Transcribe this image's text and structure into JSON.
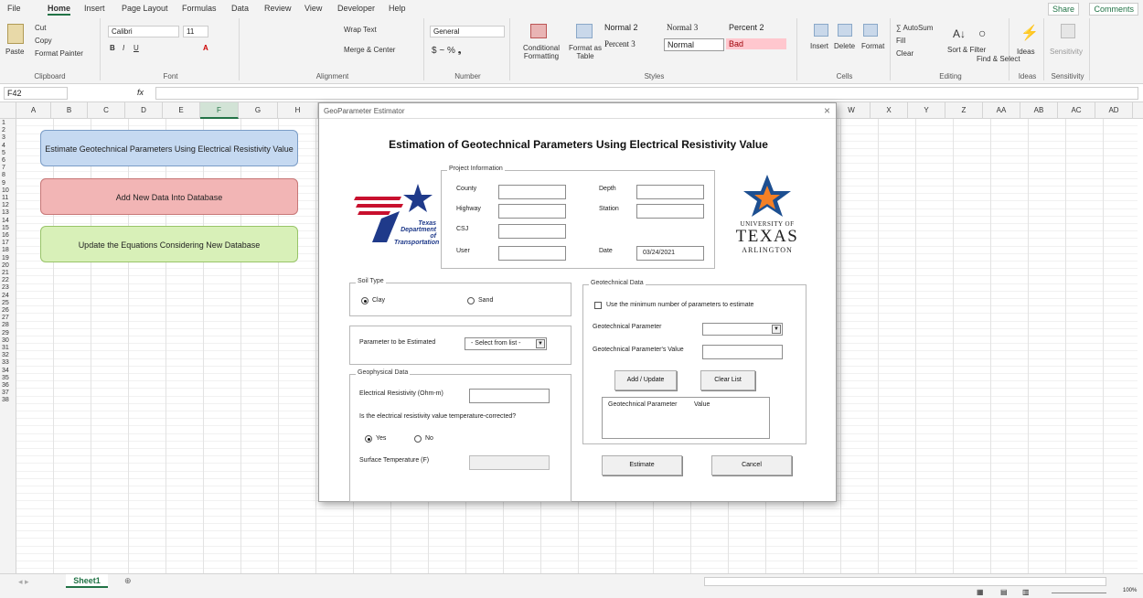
{
  "menu": {
    "file": "File",
    "home": "Home",
    "insert": "Insert",
    "page_layout": "Page Layout",
    "formulas": "Formulas",
    "data": "Data",
    "review": "Review",
    "view": "View",
    "developer": "Developer",
    "help": "Help",
    "share": "Share",
    "comments": "Comments"
  },
  "ribbon": {
    "clipboard": {
      "label": "Clipboard",
      "paste": "Paste",
      "cut": "Cut",
      "copy": "Copy",
      "format_painter": "Format Painter"
    },
    "font": {
      "label": "Font",
      "name": "Calibri",
      "size": "11"
    },
    "alignment": {
      "label": "Alignment",
      "wrap": "Wrap Text",
      "merge": "Merge & Center"
    },
    "number": {
      "label": "Number",
      "format": "General"
    },
    "styles": {
      "label": "Styles",
      "conditional": "Conditional Formatting",
      "format_as_table": "Format as Table",
      "normal2": "Normal 2",
      "normal3": "Normal 3",
      "percent2": "Percent 2",
      "percent3": "Percent 3",
      "normal": "Normal",
      "bad": "Bad"
    },
    "cells": {
      "label": "Cells",
      "insert": "Insert",
      "delete": "Delete",
      "format": "Format"
    },
    "editing": {
      "label": "Editing",
      "autosum": "AutoSum",
      "fill": "Fill",
      "clear": "Clear",
      "sort": "Sort & Filter",
      "find": "Find & Select"
    },
    "ideas": {
      "label": "Ideas",
      "btn": "Ideas"
    },
    "sensitivity": {
      "label": "Sensitivity",
      "btn": "Sensitivity"
    }
  },
  "formula_bar": {
    "name_box": "F42",
    "fx": "fx",
    "content": ""
  },
  "columns": [
    "A",
    "B",
    "C",
    "D",
    "E",
    "F",
    "G",
    "H",
    "W",
    "X",
    "Y",
    "Z",
    "AA",
    "AB",
    "AC",
    "AD"
  ],
  "sheet_buttons": {
    "estimate": "Estimate Geotechnical Parameters Using Electrical Resistivity Value",
    "add_data": "Add New Data Into Database",
    "update": "Update the Equations Considering New Database"
  },
  "sheet_tab": "Sheet1",
  "zoom": "100%",
  "dialog": {
    "window_title": "GeoParameter Estimator",
    "heading": "Estimation of Geotechnical Parameters Using Electrical Resistivity Value",
    "project": {
      "legend": "Project Information",
      "county": "County",
      "highway": "Highway",
      "csj": "CSJ",
      "user": "User",
      "depth": "Depth",
      "station": "Station",
      "date": "Date",
      "date_value": "03/24/2021"
    },
    "txdot": {
      "line1": "Texas",
      "line2": "Department",
      "line3": "of Transportation"
    },
    "uta": {
      "line1": "UNIVERSITY OF",
      "line2": "TEXAS",
      "line3": "ARLINGTON"
    },
    "soil": {
      "legend": "Soil Type",
      "clay": "Clay",
      "sand": "Sand",
      "selected": "clay"
    },
    "param": {
      "label": "Parameter to be Estimated",
      "select": "- Select from list -"
    },
    "geophys": {
      "legend": "Geophysical Data",
      "resistivity": "Electrical Resistivity (Ohm-m)",
      "question": "Is the electrical resistivity value temperature-corrected?",
      "yes": "Yes",
      "no": "No",
      "selected": "yes",
      "surface_temp": "Surface Temperature (F)"
    },
    "geotech": {
      "legend": "Geotechnical Data",
      "min_params": "Use the minimum number of parameters to estimate",
      "parameter": "Geotechnical Parameter",
      "value_label": "Geotechnical Parameter's Value",
      "add": "Add / Update",
      "clear": "Clear List",
      "col_param": "Geotechnical Parameter",
      "col_value": "Value"
    },
    "estimate": "Estimate",
    "cancel": "Cancel"
  },
  "colors": {
    "excel_green": "#217346",
    "blue_btn": "#c5d9f1",
    "red_btn": "#f2b5b5",
    "green_btn": "#d8f0b8",
    "txdot_red": "#c8102e",
    "txdot_blue": "#1f3a8a",
    "uta_blue": "#1d4f91",
    "uta_orange": "#f58025"
  }
}
